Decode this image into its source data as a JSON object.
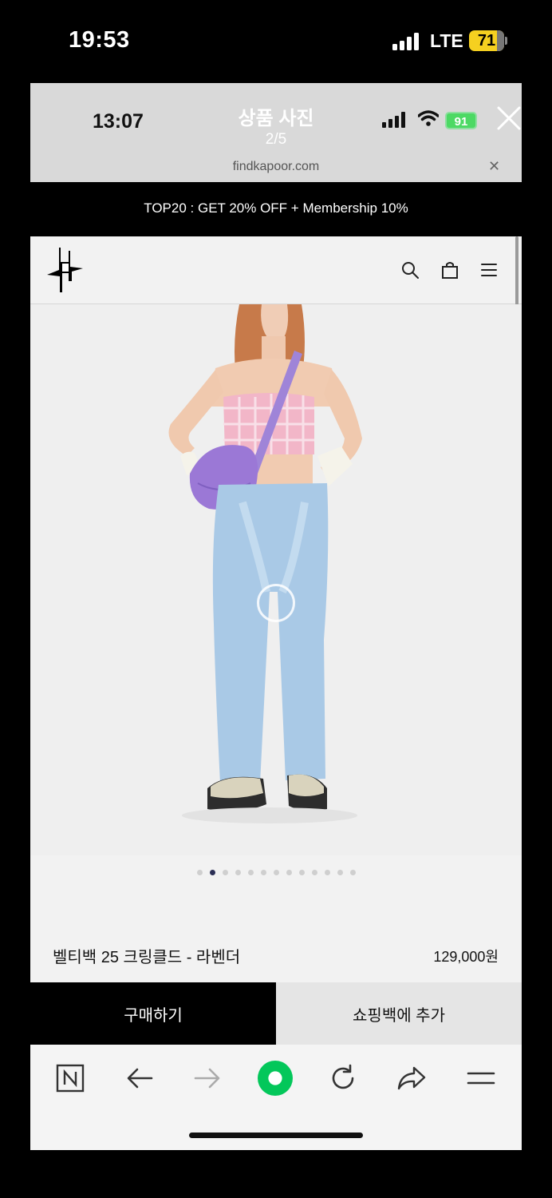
{
  "outer_status": {
    "time": "19:53",
    "network": "LTE",
    "battery": "71"
  },
  "viewer": {
    "time": "13:07",
    "title": "상품 사진",
    "counter": "2/5",
    "battery": "91",
    "url": "findkapoor.com"
  },
  "promo": {
    "text": "TOP20 : GET 20% OFF + Membership 10%"
  },
  "site": {
    "icons": [
      "search-icon",
      "shopping-bag-icon",
      "menu-icon"
    ]
  },
  "gallery": {
    "dot_count": 13,
    "active_index": 1
  },
  "product": {
    "name": "벨티백 25 크링클드 - 라벤더",
    "price": "129,000원"
  },
  "actions": {
    "buy_label": "구매하기",
    "add_to_bag_label": "쇼핑백에 추가"
  },
  "browser_toolbar": {
    "icons": [
      "naver-n-icon",
      "back-arrow-icon",
      "forward-arrow-icon",
      "green-home-icon",
      "refresh-icon",
      "share-icon",
      "menu-lines-icon"
    ]
  },
  "colors": {
    "accent_green": "#03c75a",
    "battery_outer": "#f5d020",
    "battery_inner": "#4cd964"
  }
}
